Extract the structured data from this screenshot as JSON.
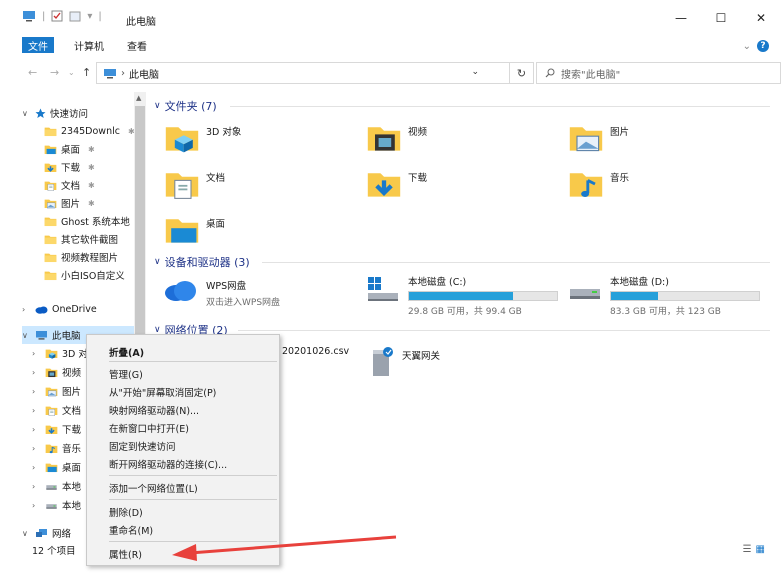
{
  "window": {
    "title": "此电脑",
    "controls": [
      "—",
      "☐",
      "✕"
    ]
  },
  "ribbon": {
    "tabs": [
      "文件",
      "计算机",
      "查看"
    ],
    "chevron": "⌄",
    "help": "?"
  },
  "address": {
    "breadcrumb_sep": "›",
    "location": "此电脑",
    "dropdown": "⌄",
    "refresh": "↻",
    "search_placeholder": "搜索\"此电脑\"",
    "back": "←",
    "forward": "→",
    "history": "⌄",
    "up": "↑"
  },
  "sidebar": {
    "quick_access": "快速访问",
    "quick_items": [
      {
        "label": "2345Downlc",
        "icon": "folder-icon",
        "pinned": true
      },
      {
        "label": "桌面",
        "icon": "desktop-icon",
        "pinned": true
      },
      {
        "label": "下载",
        "icon": "download-icon",
        "pinned": true
      },
      {
        "label": "文档",
        "icon": "document-icon",
        "pinned": true
      },
      {
        "label": "图片",
        "icon": "picture-icon",
        "pinned": true
      },
      {
        "label": "Ghost 系统本地",
        "icon": "folder-icon",
        "pinned": false
      },
      {
        "label": "其它软件截图",
        "icon": "folder-icon",
        "pinned": false
      },
      {
        "label": "视频教程图片",
        "icon": "folder-icon",
        "pinned": false
      },
      {
        "label": "小白ISO自定义",
        "icon": "folder-icon",
        "pinned": false
      }
    ],
    "onedrive": "OneDrive",
    "this_pc": "此电脑",
    "pc_items": [
      {
        "label": "3D 对",
        "icon": "3d-objects-icon"
      },
      {
        "label": "视频",
        "icon": "video-icon"
      },
      {
        "label": "图片",
        "icon": "picture-icon"
      },
      {
        "label": "文档",
        "icon": "document-icon"
      },
      {
        "label": "下载",
        "icon": "download-icon"
      },
      {
        "label": "音乐",
        "icon": "music-icon"
      },
      {
        "label": "桌面",
        "icon": "desktop-icon"
      },
      {
        "label": "本地",
        "icon": "drive-icon"
      },
      {
        "label": "本地",
        "icon": "drive-icon"
      }
    ],
    "network": "网络",
    "pin_glyph": "✱"
  },
  "main": {
    "folders_header": "文件夹 (7)",
    "folders": [
      {
        "label": "3D 对象",
        "icon": "3d-objects-icon"
      },
      {
        "label": "视频",
        "icon": "video-icon"
      },
      {
        "label": "图片",
        "icon": "picture-icon"
      },
      {
        "label": "文档",
        "icon": "document-icon"
      },
      {
        "label": "下载",
        "icon": "download-icon"
      },
      {
        "label": "音乐",
        "icon": "music-icon"
      },
      {
        "label": "桌面",
        "icon": "desktop-icon"
      }
    ],
    "devices_header": "设备和驱动器 (3)",
    "wps": {
      "name": "WPS网盘",
      "desc": "双击进入WPS网盘"
    },
    "drives": [
      {
        "name": "本地磁盘 (C:)",
        "free": "29.8 GB 可用，共 99.4 GB",
        "used_fraction": 0.7
      },
      {
        "name": "本地磁盘 (D:)",
        "free": "83.3 GB 可用，共 123 GB",
        "used_fraction": 0.32
      }
    ],
    "network_header": "网络位置 (2)",
    "network_items": [
      {
        "label": "20201026.csv"
      },
      {
        "label": "天翼网关"
      }
    ]
  },
  "context_menu": {
    "items": [
      {
        "label": "折叠(A)",
        "bold": true
      },
      {
        "label": "管理(G)"
      },
      {
        "label": "从\"开始\"屏幕取消固定(P)"
      },
      {
        "label": "映射网络驱动器(N)..."
      },
      {
        "label": "在新窗口中打开(E)"
      },
      {
        "label": "固定到快速访问"
      },
      {
        "label": "断开网络驱动器的连接(C)..."
      },
      {
        "label": "添加一个网络位置(L)"
      },
      {
        "label": "删除(D)"
      },
      {
        "label": "重命名(M)"
      },
      {
        "label": "属性(R)"
      }
    ]
  },
  "status": {
    "count": "12 个项目",
    "view_details": "☰",
    "view_tiles": "▦"
  },
  "colors": {
    "accent": "#1979ca",
    "folder": "#f8c94a",
    "drive_fill": "#26a0da",
    "arrow": "#e8413c"
  }
}
